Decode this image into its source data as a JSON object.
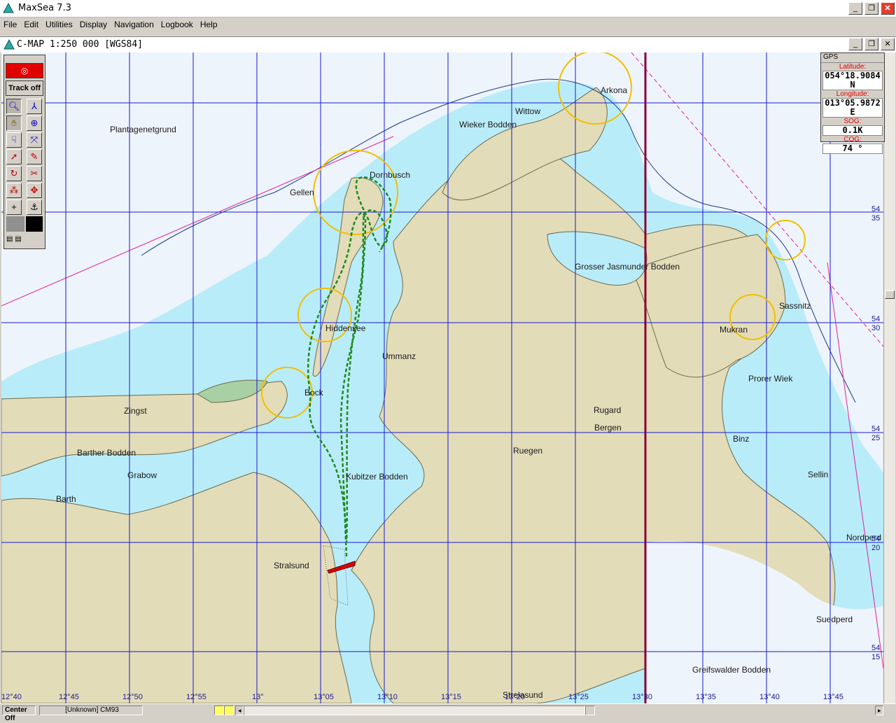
{
  "window": {
    "title": "MaxSea 7.3"
  },
  "menu": [
    "File",
    "Edit",
    "Utilities",
    "Display",
    "Navigation",
    "Logbook",
    "Help"
  ],
  "document": {
    "title": "C-MAP  1:250 000 [WGS84]"
  },
  "toolbox": {
    "track_label": "Track off"
  },
  "gps": {
    "header": "GPS",
    "latitude_label": "Latitude:",
    "latitude": "054°18.9084 N",
    "longitude_label": "Longitude:",
    "longitude": "013°05.9872 E",
    "sog_label": "SOG:",
    "sog": "0.1K",
    "cog_label": "COG:",
    "cog": "74 °"
  },
  "map": {
    "places": {
      "plantagenetgrund": "Plantagenetgrund",
      "wittow": "Wittow",
      "wieker_bodden": "Wieker Bodden",
      "arkona": "Arkona",
      "dornbusch": "Dornbusch",
      "gellen": "Gellen",
      "grosser_jasmunder": "Grosser Jasmunder Bodden",
      "sassnitz": "Sassnitz",
      "mukran": "Mukran",
      "hiddensee": "Hiddensee",
      "ummanz": "Ummanz",
      "prorer_wiek": "Prorer Wiek",
      "zingst": "Zingst",
      "bock": "Bock",
      "rugard": "Rugard",
      "bergen": "Bergen",
      "binz": "Binz",
      "barther_bodden": "Barther Bodden",
      "grabow": "Grabow",
      "ruegen": "Ruegen",
      "sellin": "Sellin",
      "barth": "Barth",
      "kubitzer_bodden": "Kubitzer Bodden",
      "stralsund": "Stralsund",
      "nordperd": "Nordperd",
      "suedperd": "Suedperd",
      "greifswalder_bodden": "Greifswalder Bodden",
      "strelasund": "Strelasund"
    },
    "lon_labels": [
      "12°40",
      "12°45",
      "12°50",
      "12°55",
      "13°",
      "13°05",
      "13°10",
      "13°15",
      "13°20",
      "13°25",
      "13°30",
      "13°35",
      "13°40",
      "13°45"
    ],
    "lat_labels": [
      {
        "deg": "54",
        "min": "35"
      },
      {
        "deg": "54",
        "min": "30"
      },
      {
        "deg": "54",
        "min": "25"
      },
      {
        "deg": "54",
        "min": "20"
      },
      {
        "deg": "54",
        "min": "15"
      }
    ]
  },
  "status": {
    "center": "Center Off",
    "chart": "[Unknown]  CM93"
  },
  "colors": {
    "land": "#e3dcb9",
    "shallow": "#b9ecf9",
    "deep": "#eef4fb",
    "grid": "#1a1ad0",
    "track": "#1f8a1f",
    "boundary": "#8a0030",
    "vessel": "#e00000"
  }
}
